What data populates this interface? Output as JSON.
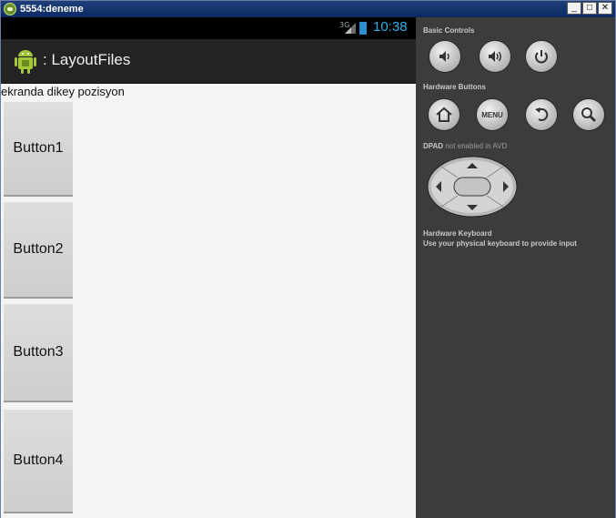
{
  "window": {
    "title": "5554:deneme",
    "controls": {
      "minimize": "_",
      "maximize": "□",
      "close": "✕"
    }
  },
  "status_bar": {
    "network": "3G",
    "time": "10:38"
  },
  "action_bar": {
    "title": ": LayoutFiles"
  },
  "content": {
    "heading": "ekranda dikey pozisyon",
    "buttons": [
      "Button1",
      "Button2",
      "Button3",
      "Button4"
    ]
  },
  "control_panel": {
    "basic_controls_label": "Basic Controls",
    "hardware_buttons_label": "Hardware Buttons",
    "menu_label": "MENU",
    "dpad_label": "DPAD",
    "dpad_status": "not enabled in AVD",
    "keyboard_label": "Hardware Keyboard",
    "keyboard_hint": "Use your physical keyboard to provide input"
  },
  "icons": {
    "basic_controls": [
      "volume-down-icon",
      "volume-up-icon",
      "power-icon"
    ],
    "hardware_buttons": [
      "home-icon",
      "menu-icon",
      "back-icon",
      "search-icon"
    ]
  },
  "colors": {
    "title_bar": "#0b2a63",
    "panel_bg": "#3c3c3c",
    "action_bar": "#232323",
    "clock": "#2bb0ea"
  }
}
